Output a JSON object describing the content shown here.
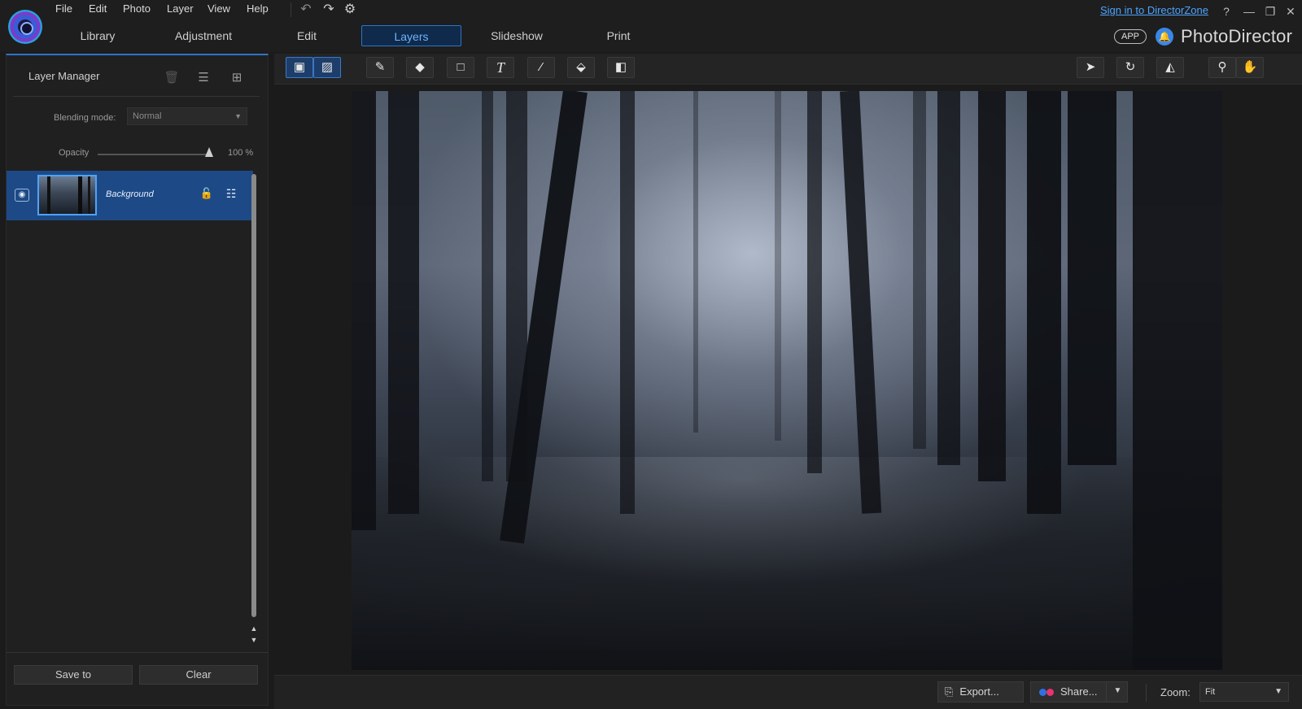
{
  "app": {
    "name": "PhotoDirector",
    "signin_link": "Sign in to DirectorZone",
    "app_badge": "APP"
  },
  "menu": [
    "File",
    "Edit",
    "Photo",
    "Layer",
    "View",
    "Help"
  ],
  "module_tabs": [
    "Library",
    "Adjustment",
    "Edit",
    "Layers",
    "Slideshow",
    "Print"
  ],
  "active_tab": "Layers",
  "layer_manager": {
    "title": "Layer Manager",
    "blending_mode_label": "Blending mode:",
    "blending_mode_value": "Normal",
    "opacity_label": "Opacity",
    "opacity_value": "100",
    "opacity_unit": "%",
    "layers": [
      {
        "name": "Background",
        "visible": true,
        "locked": true,
        "selected": true
      }
    ],
    "save_button": "Save to",
    "clear_button": "Clear"
  },
  "toolbar_icons": [
    "layer-view-icon",
    "image-view-icon",
    "pencil-icon",
    "eraser-icon",
    "rectangle-icon",
    "text-icon",
    "brush-icon",
    "fill-bucket-icon",
    "gradient-icon",
    "select-arrow-icon",
    "rotate-icon",
    "flip-icon",
    "zoom-icon",
    "pan-hand-icon"
  ],
  "bottom_bar": {
    "export_label": "Export...",
    "share_label": "Share...",
    "zoom_label": "Zoom:",
    "zoom_value": "Fit"
  },
  "colors": {
    "accent": "#2d74c8",
    "selected_row": "#1d4a86",
    "link": "#4da3ff",
    "share_dot_blue": "#2f6fe6",
    "share_dot_pink": "#e8336f"
  }
}
